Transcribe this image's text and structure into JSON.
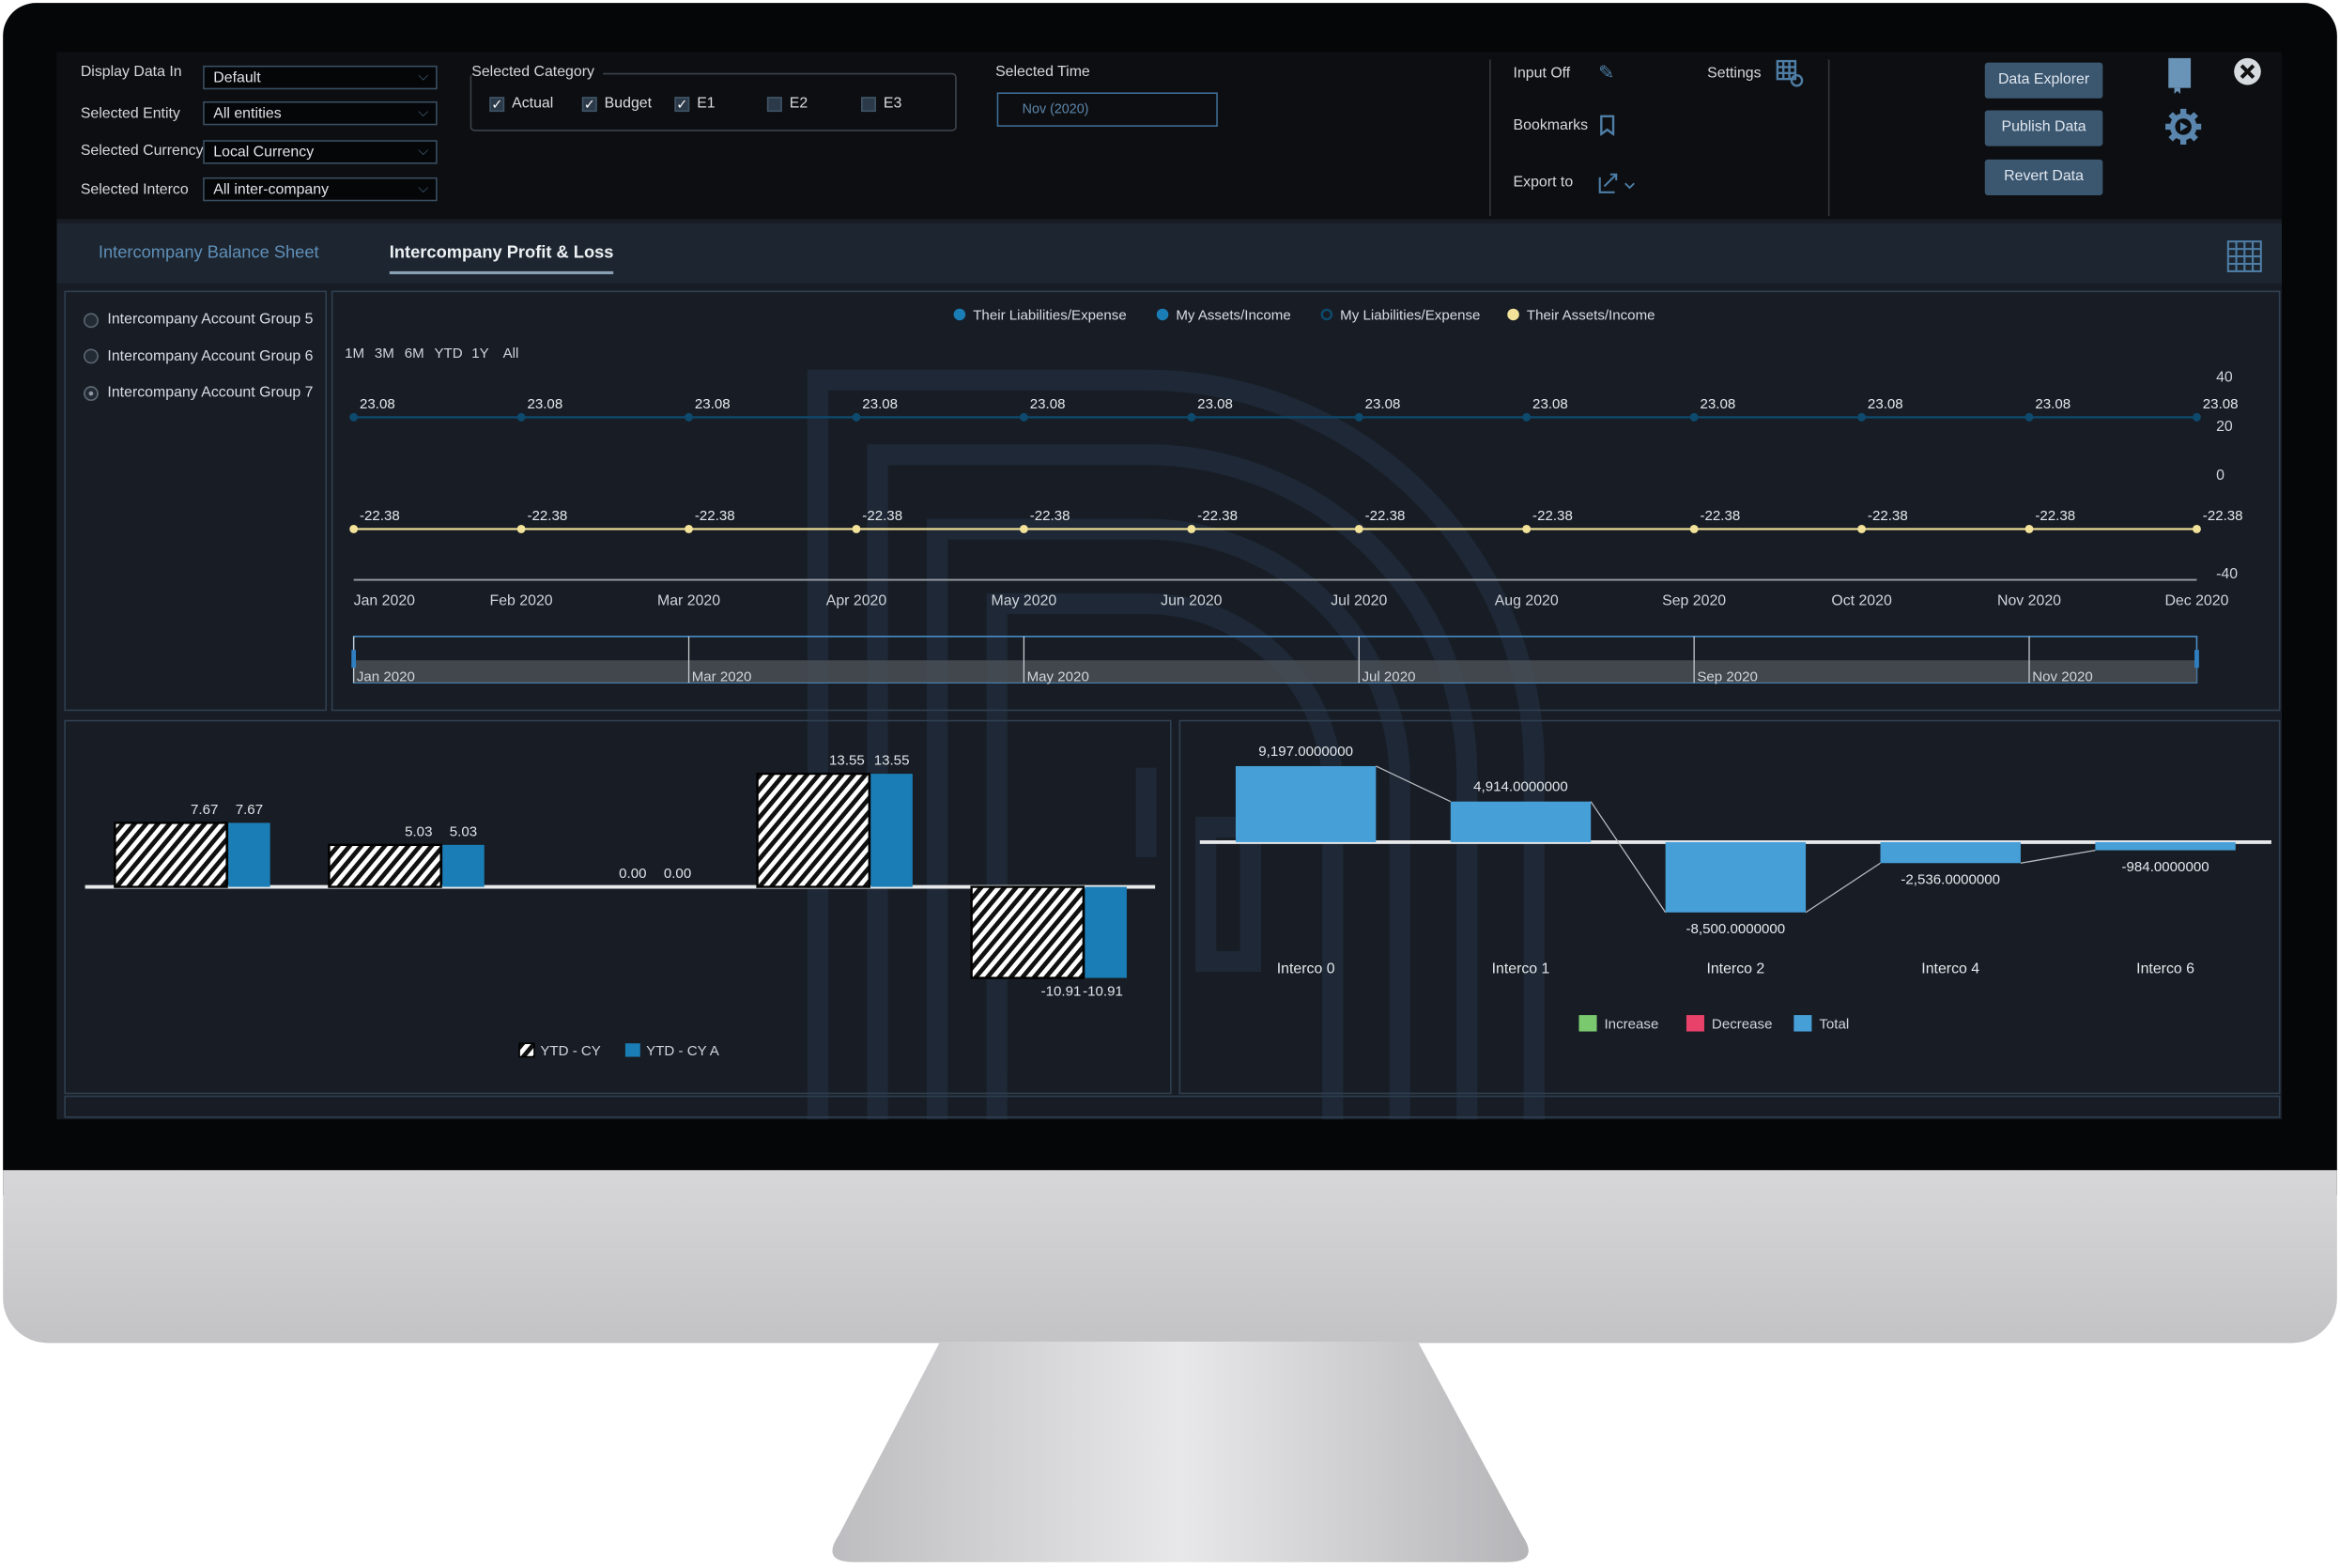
{
  "filters": {
    "display_data_in": {
      "label": "Display Data In",
      "value": "Default"
    },
    "selected_entity": {
      "label": "Selected Entity",
      "value": "All entities"
    },
    "selected_currency": {
      "label": "Selected Currency",
      "value": "Local Currency"
    },
    "selected_interco": {
      "label": "Selected Interco",
      "value": "All inter-company"
    }
  },
  "category": {
    "label": "Selected Category",
    "items": [
      {
        "label": "Actual",
        "checked": true
      },
      {
        "label": "Budget",
        "checked": true
      },
      {
        "label": "E1",
        "checked": true
      },
      {
        "label": "E2",
        "checked": false
      },
      {
        "label": "E3",
        "checked": false
      }
    ]
  },
  "time": {
    "label": "Selected Time",
    "value": "Nov (2020)"
  },
  "tools": {
    "input_off": "Input Off",
    "settings": "Settings",
    "bookmarks": "Bookmarks",
    "export_to": "Export to"
  },
  "actions": {
    "data_explorer": "Data Explorer",
    "publish_data": "Publish Data",
    "revert_data": "Revert Data"
  },
  "tabs": [
    {
      "label": "Intercompany Balance Sheet",
      "active": false
    },
    {
      "label": "Intercompany Profit & Loss",
      "active": true
    }
  ],
  "account_groups": [
    {
      "label": "Intercompany Account Group 5",
      "selected": false
    },
    {
      "label": "Intercompany Account Group 6",
      "selected": false
    },
    {
      "label": "Intercompany Account Group 7",
      "selected": true
    }
  ],
  "colors": {
    "accent": "#4e7ea6",
    "bar_blue": "#1a7db5",
    "waterfall_total": "#479fd8",
    "increase": "#7bc96f",
    "decrease": "#e8416a",
    "line_dark": "#0d4a6e",
    "line_yellow": "#f3e39a"
  },
  "chart_data": [
    {
      "type": "line",
      "range_buttons": [
        "1M",
        "3M",
        "6M",
        "YTD",
        "1Y",
        "All"
      ],
      "legend": [
        "Their Liabilities/Expense",
        "My Assets/Income",
        "My Liabilities/Expense",
        "Their Assets/Income"
      ],
      "x": [
        "Jan 2020",
        "Feb 2020",
        "Mar 2020",
        "Apr 2020",
        "May 2020",
        "Jun 2020",
        "Jul 2020",
        "Aug 2020",
        "Sep 2020",
        "Oct 2020",
        "Nov 2020",
        "Dec 2020"
      ],
      "series": [
        {
          "name": "Their Liabilities/Expense",
          "values": [
            23.08,
            23.08,
            23.08,
            23.08,
            23.08,
            23.08,
            23.08,
            23.08,
            23.08,
            23.08,
            23.08,
            23.08
          ]
        },
        {
          "name": "Their Assets/Income",
          "values": [
            -22.38,
            -22.38,
            -22.38,
            -22.38,
            -22.38,
            -22.38,
            -22.38,
            -22.38,
            -22.38,
            -22.38,
            -22.38,
            -22.38
          ]
        }
      ],
      "yticks": [
        "40",
        "20",
        "0",
        "-40"
      ],
      "ylim": [
        -40,
        40
      ],
      "navigator_labels": [
        "Jan 2020",
        "Mar 2020",
        "May 2020",
        "Jul 2020",
        "Sep 2020",
        "Nov 2020"
      ]
    },
    {
      "type": "bar",
      "legend": [
        "YTD - CY",
        "YTD - CY A"
      ],
      "series": [
        {
          "name": "YTD - CY",
          "values": [
            7.67,
            5.03,
            0.0,
            13.55,
            -10.91
          ]
        },
        {
          "name": "YTD - CY A",
          "values": [
            7.67,
            5.03,
            0.0,
            13.55,
            -10.91
          ]
        }
      ]
    },
    {
      "type": "bar",
      "subtype": "waterfall",
      "categories": [
        "Interco 0",
        "Interco 1",
        "Interco 2",
        "Interco 4",
        "Interco 6"
      ],
      "values": [
        9197,
        4914,
        -8500,
        -2536,
        -984
      ],
      "labels": [
        "9,197.0000000",
        "4,914.0000000",
        "-8,500.0000000",
        "-2,536.0000000",
        "-984.0000000"
      ],
      "legend": [
        "Increase",
        "Decrease",
        "Total"
      ]
    }
  ]
}
